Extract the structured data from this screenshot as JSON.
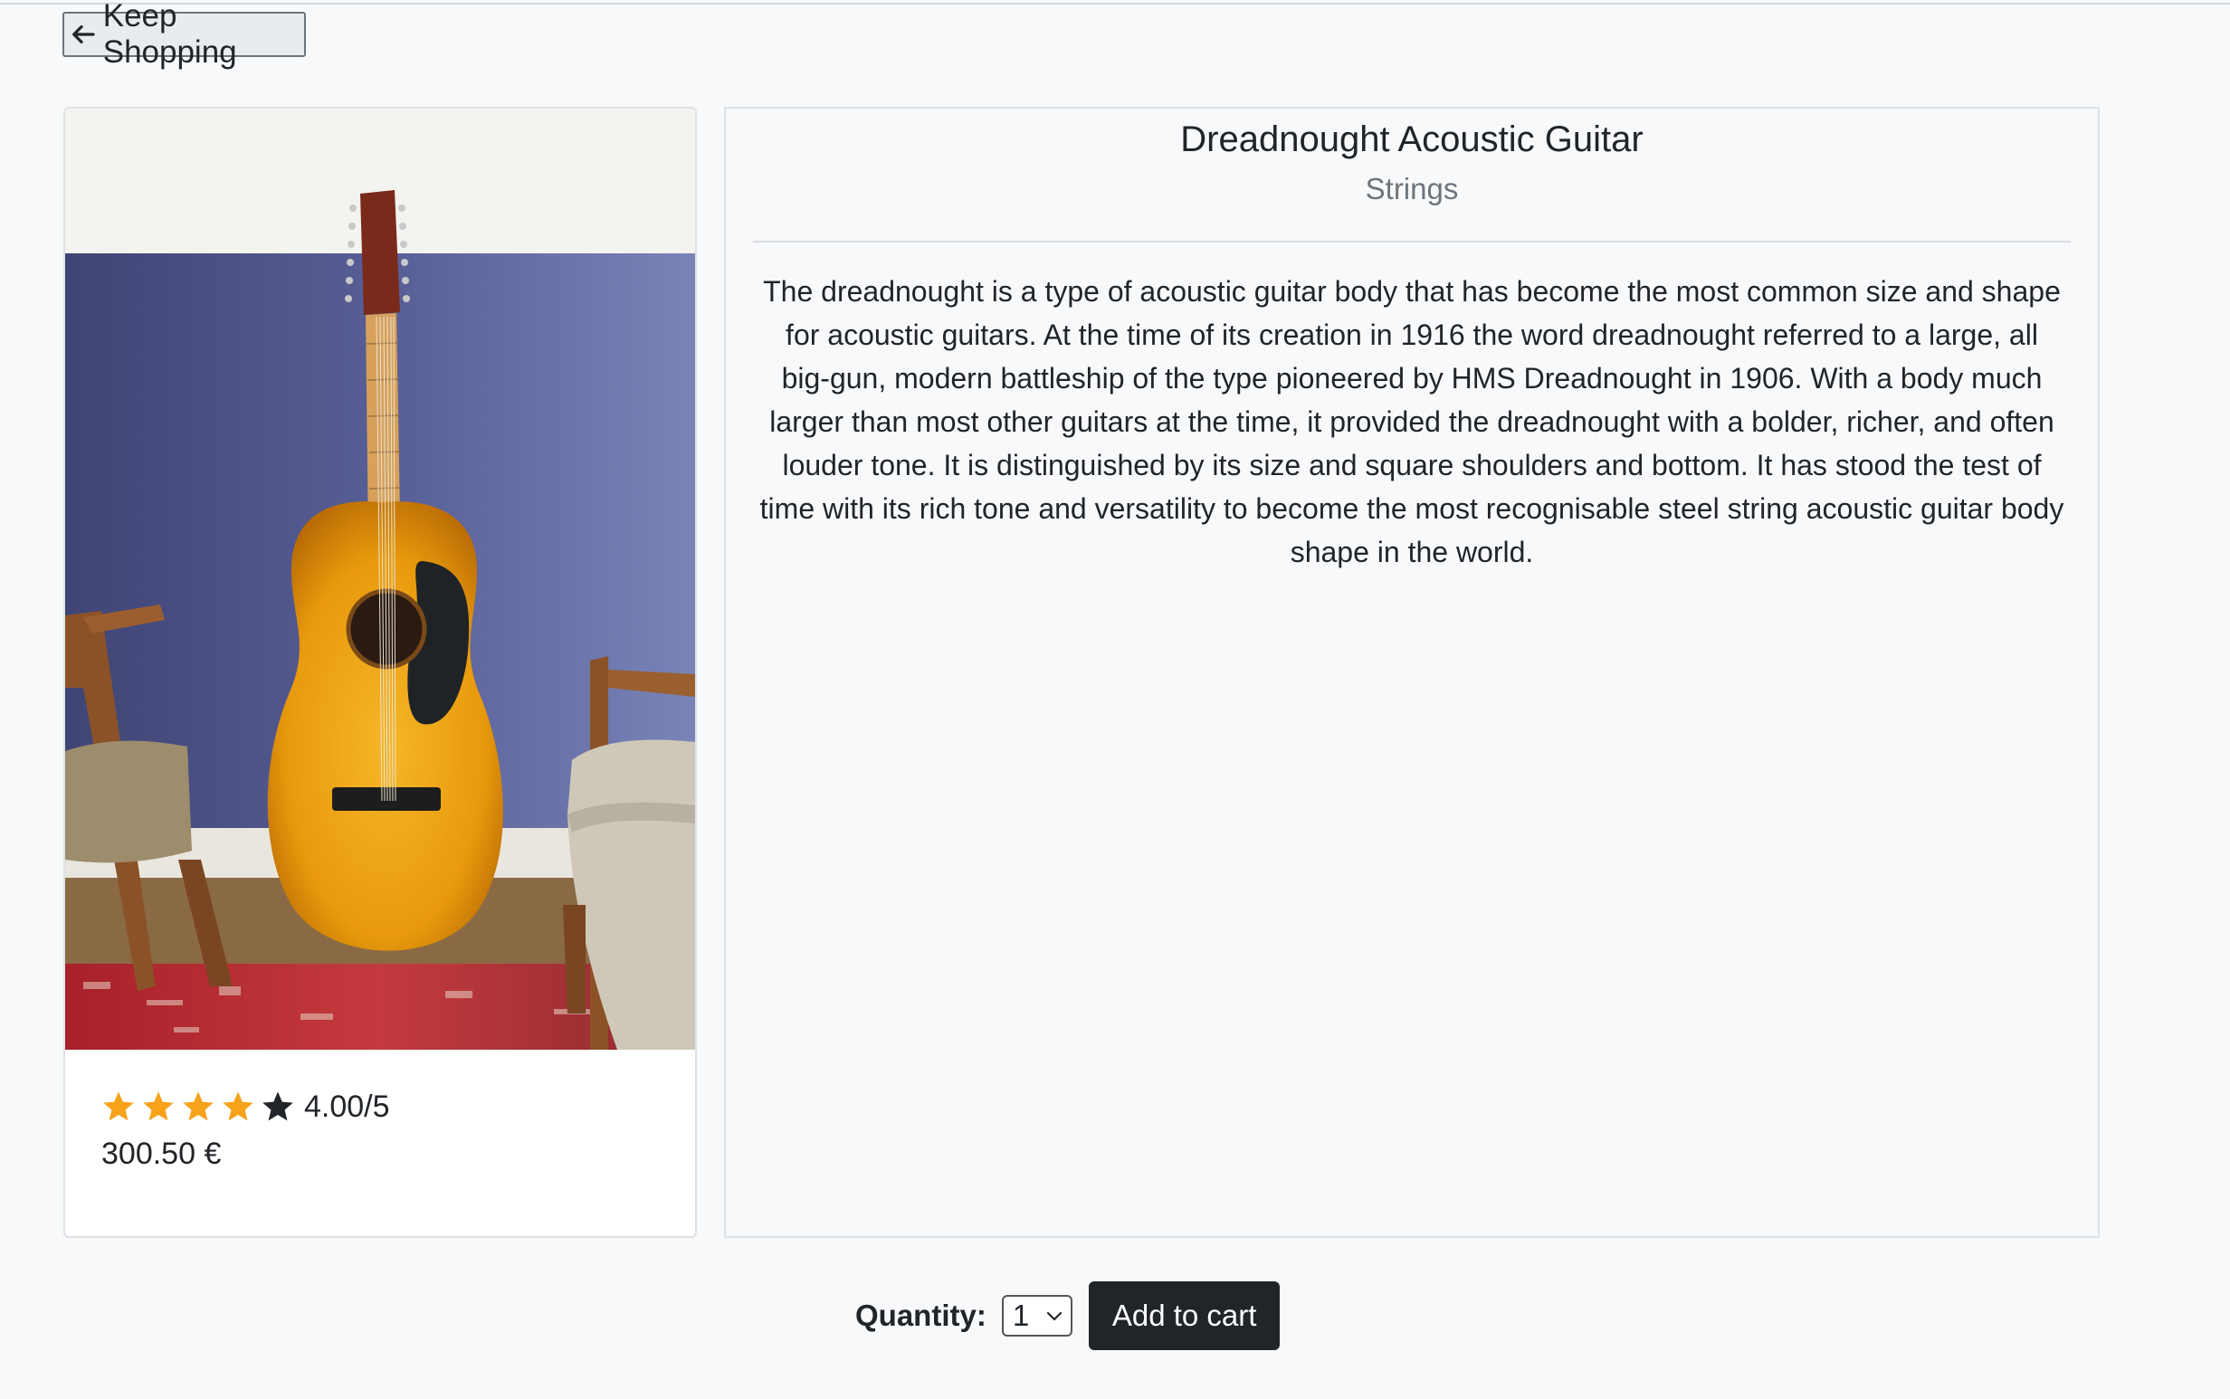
{
  "nav": {
    "back_label": "Keep Shopping",
    "back_icon": "arrow-left-icon"
  },
  "product": {
    "title": "Dreadnought Acoustic Guitar",
    "category": "Strings",
    "description": "The dreadnought is a type of acoustic guitar body that has become the most common size and shape for acoustic guitars. At the time of its creation in 1916 the word dreadnought referred to a large, all big-gun, modern battleship of the type pioneered by HMS Dreadnought in 1906. With a body much larger than most other guitars at the time, it provided the dreadnought with a bolder, richer, and often louder tone. It is distinguished by its size and square shoulders and bottom. It has stood the test of time with its rich tone and versatility to become the most recognisable steel string acoustic guitar body shape in the world.",
    "image": "acoustic-guitar-photo",
    "rating": {
      "value": 4,
      "max": 5,
      "text": "4.00/5",
      "filled_color": "#f7a21b",
      "empty_color": "#212529"
    },
    "price": "300.50 €"
  },
  "purchase": {
    "quantity_label": "Quantity:",
    "quantity_value": "1",
    "add_to_cart_label": "Add to cart"
  }
}
